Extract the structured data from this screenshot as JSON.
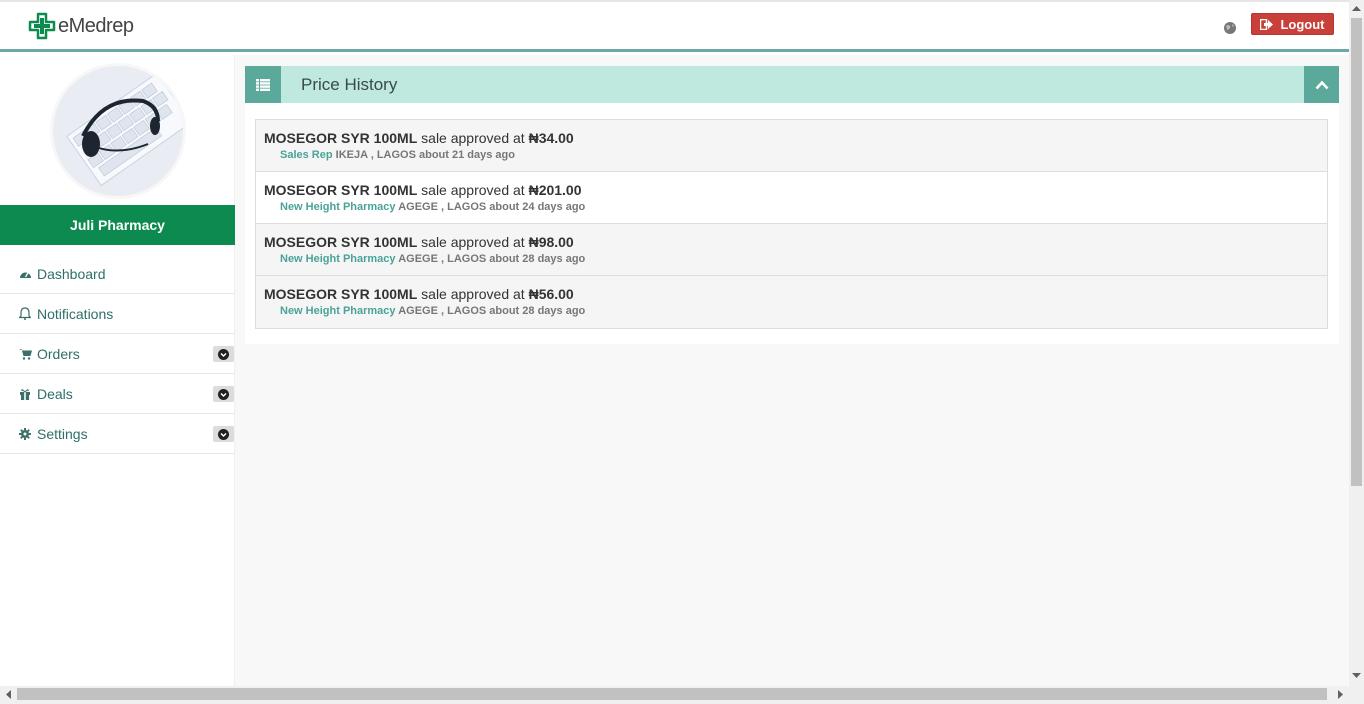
{
  "header": {
    "brand": "eMedrep",
    "logout_label": "Logout"
  },
  "sidebar": {
    "pharmacy_name": "Juli Pharmacy",
    "items": [
      {
        "label": "Dashboard",
        "icon": "dashboard-icon",
        "has_dropdown": false
      },
      {
        "label": "Notifications",
        "icon": "bell-icon",
        "has_dropdown": false
      },
      {
        "label": "Orders",
        "icon": "cart-icon",
        "has_dropdown": true
      },
      {
        "label": "Deals",
        "icon": "gift-icon",
        "has_dropdown": true
      },
      {
        "label": "Settings",
        "icon": "gear-icon",
        "has_dropdown": true
      }
    ]
  },
  "panel": {
    "title": "Price History"
  },
  "history": [
    {
      "product": "MOSEGOR SYR 100ML",
      "action": "sale approved at",
      "price": "₦34.00",
      "who": "Sales Rep",
      "location": "IKEJA , LAGOS",
      "time": "about 21 days ago"
    },
    {
      "product": "MOSEGOR SYR 100ML",
      "action": "sale approved at",
      "price": "₦201.00",
      "who": "New Height Pharmacy",
      "location": "AGEGE , LAGOS",
      "time": "about 24 days ago"
    },
    {
      "product": "MOSEGOR SYR 100ML",
      "action": "sale approved at",
      "price": "₦98.00",
      "who": "New Height Pharmacy",
      "location": "AGEGE , LAGOS",
      "time": "about 28 days ago"
    },
    {
      "product": "MOSEGOR SYR 100ML",
      "action": "sale approved at",
      "price": "₦56.00",
      "who": "New Height Pharmacy",
      "location": "AGEGE , LAGOS",
      "time": "about 28 days ago"
    }
  ],
  "colors": {
    "brand_green": "#0c8a4f",
    "accent_teal": "#5aa99a",
    "header_tint": "#bfe9df",
    "logout_red": "#c9403a"
  }
}
